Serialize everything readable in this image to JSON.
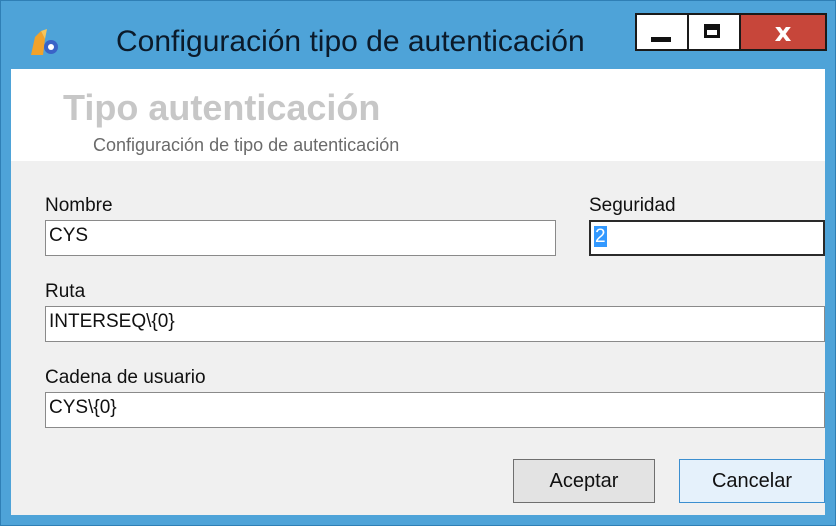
{
  "window": {
    "title": "Configuración tipo de autenticación",
    "controls": {
      "minimize": "_",
      "maximize": "□",
      "close": "x"
    },
    "accent_color": "#4ea3d8",
    "close_color": "#c7463a"
  },
  "header": {
    "title": "Tipo autenticación",
    "subtitle": "Configuración de tipo de autenticación"
  },
  "form": {
    "nombre": {
      "label": "Nombre",
      "value": "CYS"
    },
    "seguridad": {
      "label": "Seguridad",
      "value": "2"
    },
    "ruta": {
      "label": "Ruta",
      "value": "INTERSEQ\\{0}"
    },
    "cadena": {
      "label": "Cadena de usuario",
      "value": "CYS\\{0}"
    }
  },
  "buttons": {
    "accept": "Aceptar",
    "cancel": "Cancelar"
  }
}
